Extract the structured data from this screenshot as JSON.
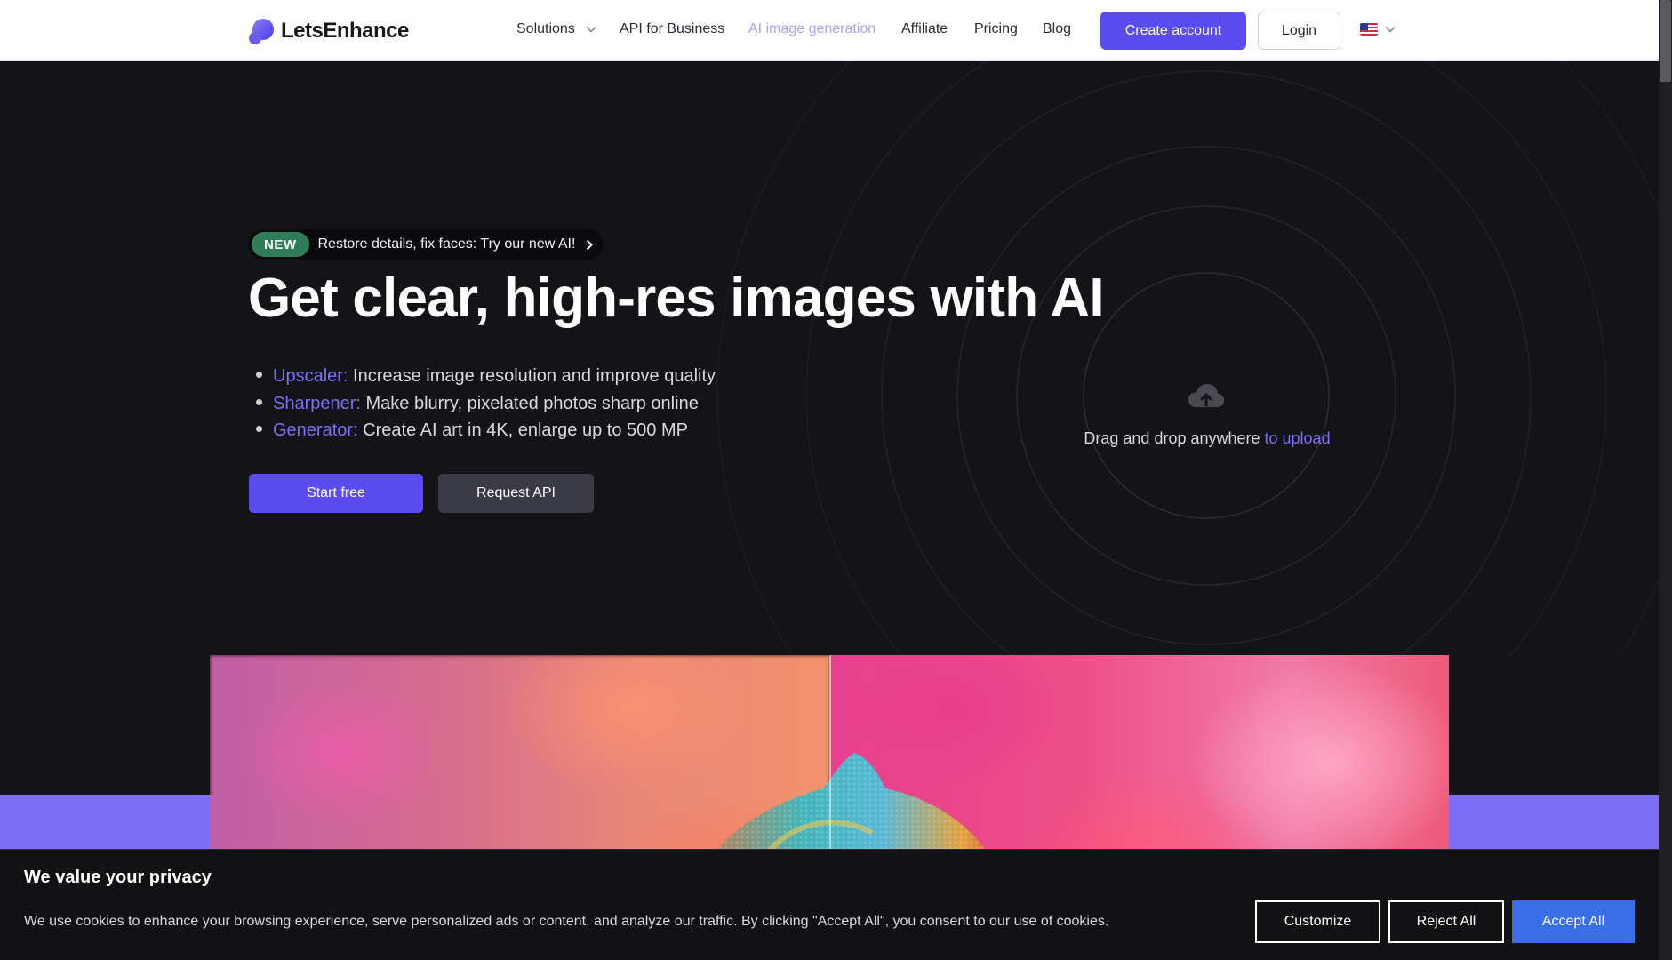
{
  "header": {
    "logo_text": "LetsEnhance",
    "nav": {
      "solutions": "Solutions",
      "api_business": "API for Business",
      "ai_generation": "AI image generation",
      "affiliate": "Affiliate",
      "pricing": "Pricing",
      "blog": "Blog"
    },
    "create_account": "Create account",
    "login": "Login",
    "language_icon": "us-flag-icon"
  },
  "hero": {
    "badge": {
      "tag": "NEW",
      "text": "Restore details, fix faces: Try our new AI!"
    },
    "title": "Get clear, high-res images with AI",
    "features": [
      {
        "name": "Upscaler:",
        "text": " Increase image resolution and improve quality"
      },
      {
        "name": "Sharpener:",
        "text": " Make blurry, pixelated photos sharp online"
      },
      {
        "name": "Generator:",
        "text": " Create AI art in 4K, enlarge up to 500 MP"
      }
    ],
    "start_free": "Start free",
    "request_api": "Request API"
  },
  "upload": {
    "text": "Drag and drop anywhere ",
    "link": "to upload"
  },
  "cookie": {
    "title": "We value your privacy",
    "text": "We use cookies to enhance your browsing experience, serve personalized ads or content, and analyze our traffic. By clicking \"Accept All\", you consent to our use of cookies.",
    "customize": "Customize",
    "reject_all": "Reject All",
    "accept_all": "Accept All"
  },
  "colors": {
    "accent": "#5b4cf0",
    "accent_light": "#7c6ff5",
    "hero_bg": "#141418",
    "badge_green": "#2e7c58",
    "accept_blue": "#3a6ee6"
  }
}
